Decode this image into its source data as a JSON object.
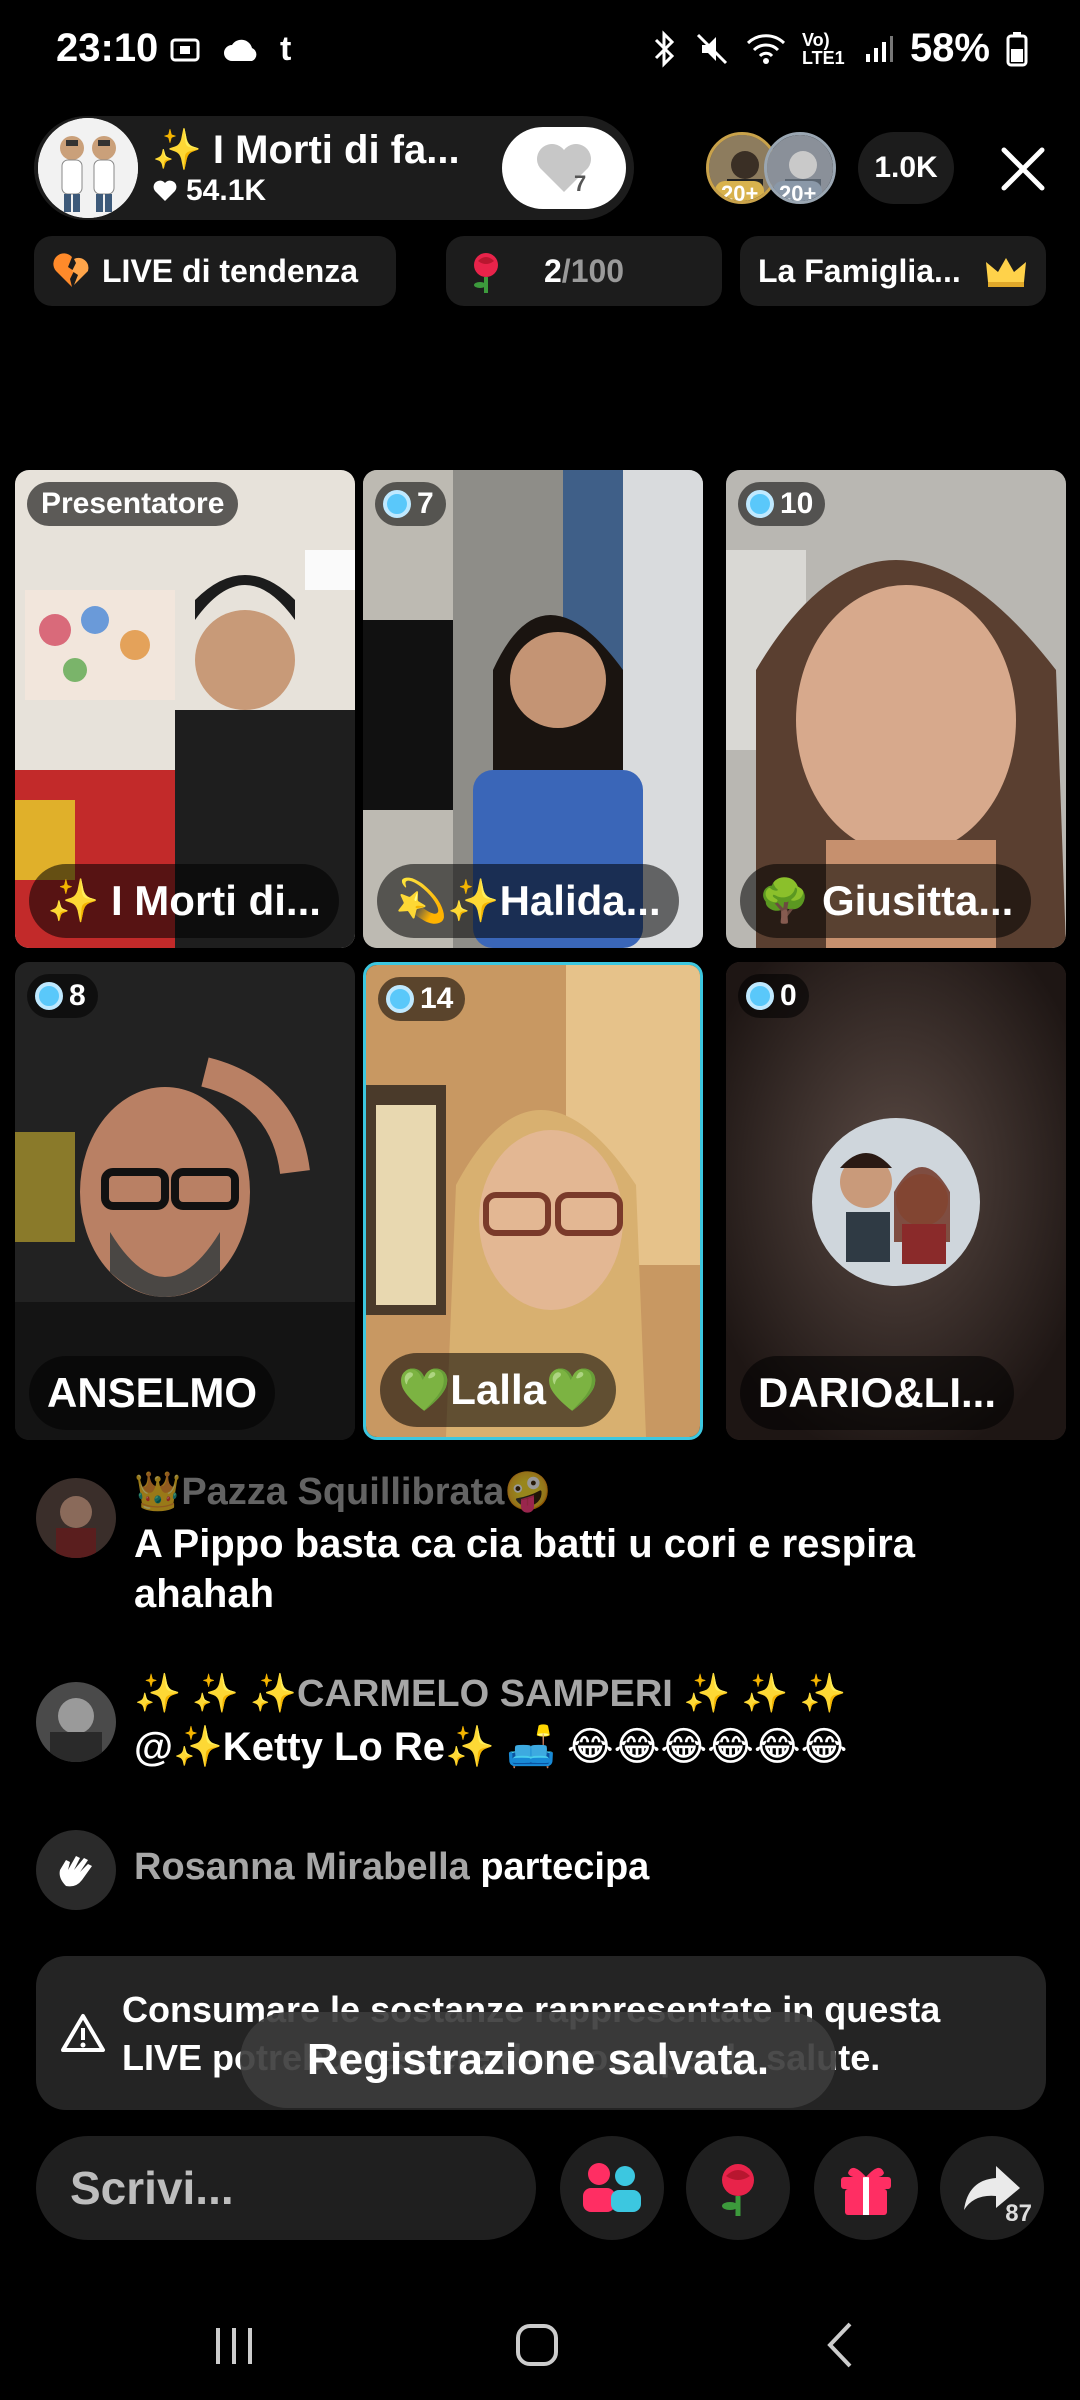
{
  "status_bar": {
    "time": "23:10",
    "battery": "58%",
    "network": "Vo) LTE1",
    "icons": [
      "screen-record-icon",
      "cloud-icon",
      "t-app-icon",
      "bluetooth-icon",
      "mute-icon",
      "wifi-icon",
      "signal-icon",
      "battery-icon"
    ]
  },
  "header": {
    "host_name": "✨ I Morti di fa...",
    "host_likes": "54.1K",
    "follow_level": "7",
    "viewer_badges": [
      "20+",
      "20+"
    ],
    "viewer_count": "1.0K"
  },
  "chips": {
    "trending": "LIVE di tendenza",
    "roses": "2",
    "roses_total": "/100",
    "family": "La Famiglia..."
  },
  "grid": [
    {
      "badge": "Presentatore",
      "name": "✨ I Morti di..."
    },
    {
      "badge": "7",
      "name": "💫✨Halida..."
    },
    {
      "badge": "10",
      "name": "🌳 Giusitta..."
    },
    {
      "badge": "8",
      "name": "ANSELMO"
    },
    {
      "badge": "14",
      "name": "💚Lalla💚"
    },
    {
      "badge": "0",
      "name": "DARIO&LI..."
    }
  ],
  "chat": [
    {
      "user": "👑Pazza Squillibrata🤪",
      "message": "A Pippo basta ca cia batti u cori e respira ahahah"
    },
    {
      "user": "✨ ✨ ✨CARMELO SAMPERI ✨ ✨ ✨",
      "message": "@✨Ketty Lo Re✨ 🛋️ 😂😂😂😂😂😂"
    }
  ],
  "join": {
    "user": "Rosanna Mirabella",
    "action": "partecipa"
  },
  "warning": "Consumare le sostanze rappresentate in questa LIVE potrebbe essere dannoso per la salute.",
  "toast": "Registrazione salvata.",
  "input": {
    "placeholder": "Scrivi..."
  },
  "share_count": "87",
  "colors": {
    "accent_cyan": "#3cc7e0",
    "gift_pink": "#ff2e63",
    "rose_red": "#e8234a",
    "badge_blue": "#5ac8fa"
  }
}
